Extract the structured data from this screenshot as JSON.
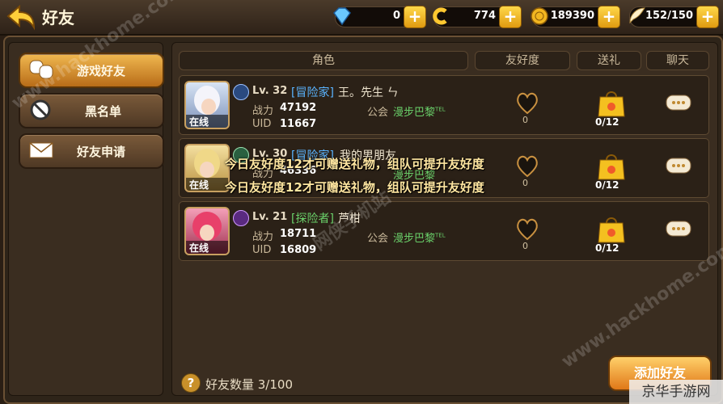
{
  "header": {
    "title": "好友",
    "resources": [
      {
        "icon": "diamond-icon",
        "value": "0"
      },
      {
        "icon": "c-coin-icon",
        "value": "774"
      },
      {
        "icon": "gold-coin-icon",
        "value": "189390"
      },
      {
        "icon": "wing-stamina-icon",
        "value": "152/150"
      }
    ],
    "plus_label": "+"
  },
  "sidebar": {
    "items": [
      {
        "label": "游戏好友",
        "icon": "friends-icon",
        "active": true
      },
      {
        "label": "黑名单",
        "icon": "block-icon",
        "active": false
      },
      {
        "label": "好友申请",
        "icon": "mail-icon",
        "active": false
      }
    ]
  },
  "table": {
    "headers": [
      "角色",
      "友好度",
      "送礼",
      "聊天"
    ],
    "online_label": "在线",
    "power_label": "战力",
    "uid_label": "UID",
    "guild_label": "公会",
    "rows": [
      {
        "level": "Lv. 32",
        "job": "[冒险家]",
        "name": "王。先生 ㄣ",
        "power": "47192",
        "uid": "11667",
        "guild": "漫步巴黎",
        "guild_sup": "TEL",
        "friendship": "0",
        "gifts": "0/12"
      },
      {
        "level": "Lv. 30",
        "job": "[冒险家]",
        "name": "我的男朋友",
        "power": "46336",
        "uid": "",
        "guild": "漫步巴黎",
        "guild_sup": "",
        "friendship": "0",
        "gifts": "0/12"
      },
      {
        "level": "Lv. 21",
        "job": "[探险者]",
        "name": "芦柑",
        "power": "18711",
        "uid": "16809",
        "guild": "漫步巴黎",
        "guild_sup": "TEL",
        "friendship": "0",
        "gifts": "0/12"
      }
    ]
  },
  "notices": [
    "今日友好度12才可赠送礼物，组队可提升友好度",
    "今日友好度12才可赠送礼物，组队可提升友好度"
  ],
  "footer": {
    "help": "?",
    "friend_count": "好友数量 3/100",
    "add_button": "添加好友"
  },
  "watermarks": {
    "diag_left": "www.hackhome.com",
    "diag_center": "网侠手机站",
    "diag_right": "www.hackhome.com",
    "brand": "京华手游网"
  }
}
